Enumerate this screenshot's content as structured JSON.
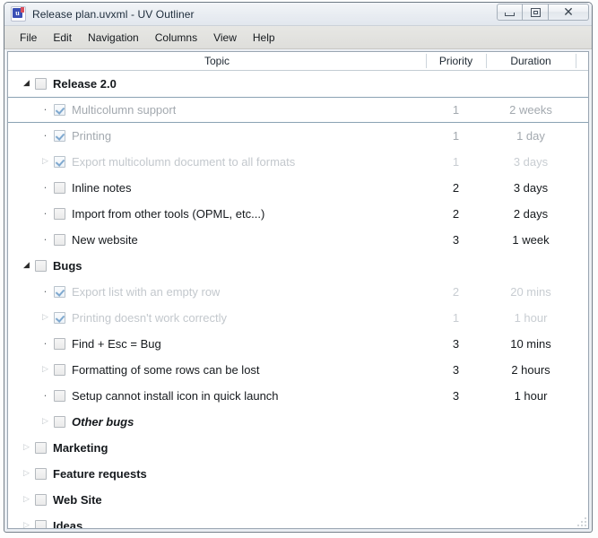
{
  "window": {
    "title": "Release plan.uvxml - UV Outliner",
    "app_icon": "uv-outliner-icon",
    "controls": {
      "minimize": "Minimize",
      "maximize": "Maximize",
      "close": "Close"
    }
  },
  "menubar": {
    "items": [
      {
        "label": "File"
      },
      {
        "label": "Edit"
      },
      {
        "label": "Navigation"
      },
      {
        "label": "Columns"
      },
      {
        "label": "View"
      },
      {
        "label": "Help"
      }
    ]
  },
  "outline": {
    "columns": [
      {
        "key": "topic",
        "label": "Topic"
      },
      {
        "key": "priority",
        "label": "Priority"
      },
      {
        "key": "duration",
        "label": "Duration"
      }
    ],
    "rows": [
      {
        "topic": "Release 2.0",
        "priority": "",
        "duration": "",
        "indent": 0,
        "marker": "expanded",
        "checked": false,
        "style": "group",
        "selected": false
      },
      {
        "topic": "Multicolumn support",
        "priority": "1",
        "duration": "2 weeks",
        "indent": 1,
        "marker": "bullet",
        "checked": true,
        "style": "done",
        "selected": true
      },
      {
        "topic": "Printing",
        "priority": "1",
        "duration": "1 day",
        "indent": 1,
        "marker": "bullet",
        "checked": true,
        "style": "done",
        "selected": false
      },
      {
        "topic": "Export multicolumn document to all formats",
        "priority": "1",
        "duration": "3 days",
        "indent": 1,
        "marker": "collapsed",
        "checked": true,
        "style": "done-faded",
        "selected": false
      },
      {
        "topic": "Inline notes",
        "priority": "2",
        "duration": "3 days",
        "indent": 1,
        "marker": "bullet",
        "checked": false,
        "style": "",
        "selected": false
      },
      {
        "topic": "Import from other tools (OPML, etc...)",
        "priority": "2",
        "duration": "2 days",
        "indent": 1,
        "marker": "bullet",
        "checked": false,
        "style": "",
        "selected": false
      },
      {
        "topic": "New website",
        "priority": "3",
        "duration": "1 week",
        "indent": 1,
        "marker": "bullet",
        "checked": false,
        "style": "",
        "selected": false
      },
      {
        "topic": "Bugs",
        "priority": "",
        "duration": "",
        "indent": 0,
        "marker": "expanded",
        "checked": false,
        "style": "group",
        "selected": false
      },
      {
        "topic": "Export list with an empty row",
        "priority": "2",
        "duration": "20 mins",
        "indent": 1,
        "marker": "bullet",
        "checked": true,
        "style": "done-faded",
        "selected": false
      },
      {
        "topic": "Printing doesn't work correctly",
        "priority": "1",
        "duration": "1 hour",
        "indent": 1,
        "marker": "collapsed",
        "checked": true,
        "style": "done-faded",
        "selected": false
      },
      {
        "topic": "Find + Esc = Bug",
        "priority": "3",
        "duration": "10 mins",
        "indent": 1,
        "marker": "bullet",
        "checked": false,
        "style": "",
        "selected": false
      },
      {
        "topic": "Formatting of some rows can be lost",
        "priority": "3",
        "duration": "2 hours",
        "indent": 1,
        "marker": "collapsed",
        "checked": false,
        "style": "",
        "selected": false
      },
      {
        "topic": "Setup cannot install icon in quick launch",
        "priority": "3",
        "duration": "1 hour",
        "indent": 1,
        "marker": "bullet",
        "checked": false,
        "style": "",
        "selected": false
      },
      {
        "topic": "Other bugs",
        "priority": "",
        "duration": "",
        "indent": 1,
        "marker": "collapsed",
        "checked": false,
        "style": "italic",
        "selected": false
      },
      {
        "topic": "Marketing",
        "priority": "",
        "duration": "",
        "indent": 0,
        "marker": "collapsed",
        "checked": false,
        "style": "group",
        "selected": false
      },
      {
        "topic": "Feature requests",
        "priority": "",
        "duration": "",
        "indent": 0,
        "marker": "collapsed",
        "checked": false,
        "style": "group",
        "selected": false
      },
      {
        "topic": "Web Site",
        "priority": "",
        "duration": "",
        "indent": 0,
        "marker": "collapsed",
        "checked": false,
        "style": "group",
        "selected": false
      },
      {
        "topic": "Ideas",
        "priority": "",
        "duration": "",
        "indent": 0,
        "marker": "collapsed",
        "checked": false,
        "style": "group",
        "selected": false
      }
    ]
  },
  "glyphs": {
    "expanded": "◢",
    "collapsed": "▷",
    "bullet": "·",
    "close": "✕"
  },
  "colors": {
    "accent": "#3a4fb5",
    "selection_border": "#8aa2b4",
    "done_text": "#a3a9af",
    "faded_text": "#c3c8cd",
    "check_mark": "#7ea8cf"
  }
}
